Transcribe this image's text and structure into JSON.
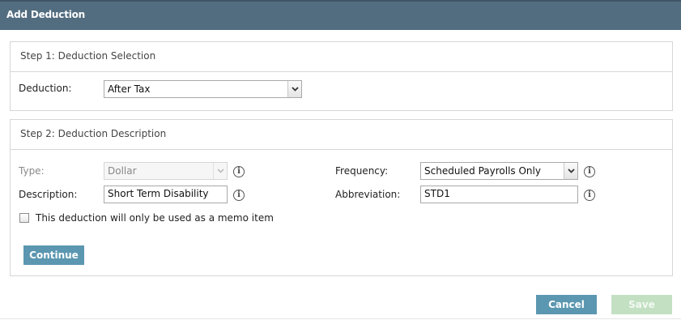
{
  "dialog": {
    "title": "Add Deduction"
  },
  "step1": {
    "title": "Step 1: Deduction Selection",
    "deduction_label": "Deduction:",
    "deduction_value": "After Tax"
  },
  "step2": {
    "title": "Step 2: Deduction Description",
    "type_label": "Type:",
    "type_value": "Dollar",
    "description_label": "Description:",
    "description_value": "Short Term Disability",
    "frequency_label": "Frequency:",
    "frequency_value": "Scheduled Payrolls Only",
    "abbreviation_label": "Abbreviation:",
    "abbreviation_value": "STD1",
    "memo_label": "This deduction will only be used as a memo item",
    "memo_checked": false,
    "continue_label": "Continue",
    "info_glyph": "i"
  },
  "footer": {
    "cancel_label": "Cancel",
    "save_label": "Save"
  },
  "colors": {
    "titlebar": "#536d80",
    "primary_button": "#5b97b0",
    "save_disabled": "#c3e0c3"
  }
}
